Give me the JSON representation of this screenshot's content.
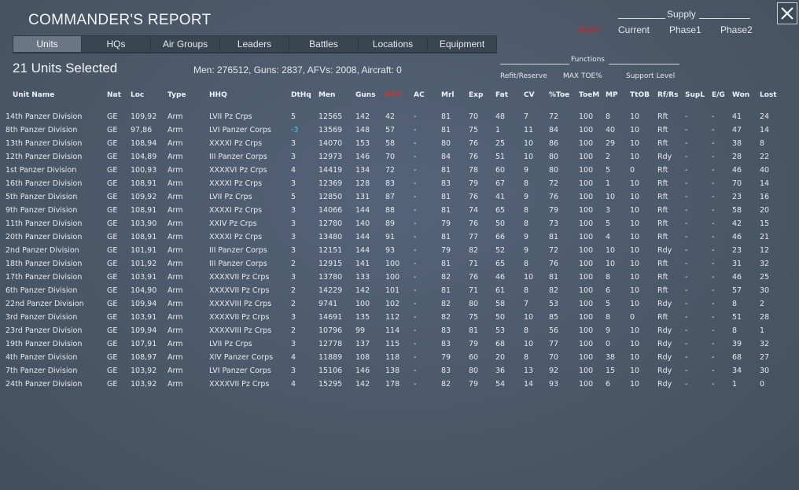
{
  "window": {
    "title": "COMMANDER'S REPORT"
  },
  "supply": {
    "label": "Supply",
    "options": [
      {
        "label": "Main*",
        "active": true
      },
      {
        "label": "Current",
        "active": false
      },
      {
        "label": "Phase1",
        "active": false
      },
      {
        "label": "Phase2",
        "active": false
      }
    ]
  },
  "tabs": [
    {
      "label": "Units",
      "active": true
    },
    {
      "label": "HQs",
      "active": false
    },
    {
      "label": "Air Groups",
      "active": false
    },
    {
      "label": "Leaders",
      "active": false
    },
    {
      "label": "Battles",
      "active": false
    },
    {
      "label": "Locations",
      "active": false
    },
    {
      "label": "Equipment",
      "active": false
    }
  ],
  "selection": {
    "title": "21 Units Selected",
    "summary": "Men: 276512, Guns: 2837, AFVs: 2008, Aircraft: 0"
  },
  "functions": {
    "label": "Functions",
    "options": [
      "Refit/Reserve",
      "MAX TOE%",
      "Support Level"
    ]
  },
  "table": {
    "sort_column": "AFV",
    "columns": [
      "Unit Name",
      "Nat",
      "Loc",
      "Type",
      "HHQ",
      "DtHq",
      "Men",
      "Guns",
      "AFV",
      "AC",
      "Mrl",
      "Exp",
      "Fat",
      "CV",
      "%Toe",
      "ToeM",
      "MP",
      "TtOB",
      "Rf/Rs",
      "SupL",
      "E/G",
      "Won",
      "Lost"
    ],
    "rows": [
      [
        "14th Panzer Division",
        "GE",
        "109,92",
        "Arm",
        "LVII Pz Crps",
        "5",
        "12565",
        "142",
        "42",
        "-",
        "81",
        "70",
        "48",
        "7",
        "72",
        "100",
        "8",
        "10",
        "Rft",
        "-",
        "-",
        "41",
        "24"
      ],
      [
        "8th Panzer Division",
        "GE",
        "97,86",
        "Arm",
        "LVI Panzer Corps",
        "-3",
        "13569",
        "148",
        "57",
        "-",
        "81",
        "75",
        "1",
        "11",
        "84",
        "100",
        "40",
        "10",
        "Rft",
        "-",
        "-",
        "47",
        "14"
      ],
      [
        "13th Panzer Division",
        "GE",
        "108,94",
        "Arm",
        "XXXXI Pz Crps",
        "3",
        "14070",
        "153",
        "58",
        "-",
        "80",
        "76",
        "25",
        "10",
        "86",
        "100",
        "29",
        "10",
        "Rft",
        "-",
        "-",
        "38",
        "8"
      ],
      [
        "12th Panzer Division",
        "GE",
        "104,89",
        "Arm",
        "III Panzer Corps",
        "3",
        "12973",
        "146",
        "70",
        "-",
        "84",
        "76",
        "51",
        "10",
        "80",
        "100",
        "2",
        "10",
        "Rdy",
        "-",
        "-",
        "28",
        "22"
      ],
      [
        "1st Panzer Division",
        "GE",
        "100,93",
        "Arm",
        "XXXXVI Pz Crps",
        "4",
        "14419",
        "134",
        "72",
        "-",
        "81",
        "78",
        "60",
        "9",
        "80",
        "100",
        "5",
        "0",
        "Rft",
        "-",
        "-",
        "46",
        "40"
      ],
      [
        "16th Panzer Division",
        "GE",
        "108,91",
        "Arm",
        "XXXXI Pz Crps",
        "3",
        "12369",
        "128",
        "83",
        "-",
        "83",
        "79",
        "67",
        "8",
        "72",
        "100",
        "1",
        "10",
        "Rft",
        "-",
        "-",
        "70",
        "14"
      ],
      [
        "5th Panzer Division",
        "GE",
        "109,92",
        "Arm",
        "LVII Pz Crps",
        "5",
        "12850",
        "131",
        "87",
        "-",
        "81",
        "76",
        "41",
        "9",
        "76",
        "100",
        "10",
        "10",
        "Rft",
        "-",
        "-",
        "23",
        "16"
      ],
      [
        "9th Panzer Division",
        "GE",
        "108,91",
        "Arm",
        "XXXXI Pz Crps",
        "3",
        "14066",
        "144",
        "88",
        "-",
        "81",
        "74",
        "65",
        "8",
        "79",
        "100",
        "3",
        "10",
        "Rft",
        "-",
        "-",
        "58",
        "20"
      ],
      [
        "11th Panzer Division",
        "GE",
        "103,90",
        "Arm",
        "XXIV Pz Crps",
        "3",
        "12780",
        "140",
        "89",
        "-",
        "79",
        "76",
        "50",
        "8",
        "73",
        "100",
        "5",
        "10",
        "Rft",
        "-",
        "-",
        "42",
        "15"
      ],
      [
        "20th Panzer Division",
        "GE",
        "108,91",
        "Arm",
        "XXXXI Pz Crps",
        "3",
        "13480",
        "144",
        "91",
        "-",
        "81",
        "77",
        "66",
        "9",
        "81",
        "100",
        "4",
        "10",
        "Rft",
        "-",
        "-",
        "46",
        "21"
      ],
      [
        "2nd Panzer Division",
        "GE",
        "101,91",
        "Arm",
        "III Panzer Corps",
        "3",
        "12151",
        "144",
        "93",
        "-",
        "79",
        "82",
        "52",
        "9",
        "72",
        "100",
        "10",
        "10",
        "Rdy",
        "-",
        "-",
        "23",
        "12"
      ],
      [
        "18th Panzer Division",
        "GE",
        "101,92",
        "Arm",
        "III Panzer Corps",
        "2",
        "12915",
        "141",
        "100",
        "-",
        "81",
        "71",
        "65",
        "8",
        "76",
        "100",
        "10",
        "10",
        "Rft",
        "-",
        "-",
        "31",
        "32"
      ],
      [
        "17th Panzer Division",
        "GE",
        "103,91",
        "Arm",
        "XXXXVII Pz Crps",
        "3",
        "13780",
        "133",
        "100",
        "-",
        "82",
        "76",
        "46",
        "10",
        "81",
        "100",
        "8",
        "10",
        "Rft",
        "-",
        "-",
        "46",
        "25"
      ],
      [
        "6th Panzer Division",
        "GE",
        "104,90",
        "Arm",
        "XXXXVII Pz Crps",
        "2",
        "14229",
        "142",
        "101",
        "-",
        "81",
        "71",
        "61",
        "8",
        "82",
        "100",
        "6",
        "10",
        "Rft",
        "-",
        "-",
        "57",
        "30"
      ],
      [
        "22nd Panzer Division",
        "GE",
        "109,94",
        "Arm",
        "XXXXVIII Pz Crps",
        "2",
        "9741",
        "100",
        "102",
        "-",
        "82",
        "80",
        "58",
        "7",
        "53",
        "100",
        "5",
        "10",
        "Rdy",
        "-",
        "-",
        "8",
        "2"
      ],
      [
        "3rd Panzer Division",
        "GE",
        "103,91",
        "Arm",
        "XXXXVII Pz Crps",
        "3",
        "14691",
        "135",
        "112",
        "-",
        "82",
        "75",
        "50",
        "10",
        "85",
        "100",
        "8",
        "0",
        "Rft",
        "-",
        "-",
        "51",
        "28"
      ],
      [
        "23rd Panzer Division",
        "GE",
        "109,94",
        "Arm",
        "XXXXVIII Pz Crps",
        "2",
        "10796",
        "99",
        "114",
        "-",
        "83",
        "81",
        "53",
        "8",
        "56",
        "100",
        "9",
        "10",
        "Rdy",
        "-",
        "-",
        "8",
        "1"
      ],
      [
        "19th Panzer Division",
        "GE",
        "107,91",
        "Arm",
        "LVII Pz Crps",
        "3",
        "12778",
        "137",
        "115",
        "-",
        "83",
        "79",
        "68",
        "10",
        "77",
        "100",
        "0",
        "10",
        "Rdy",
        "-",
        "-",
        "39",
        "32"
      ],
      [
        "4th Panzer Division",
        "GE",
        "108,97",
        "Arm",
        "XIV Panzer Corps",
        "4",
        "11889",
        "108",
        "118",
        "-",
        "79",
        "60",
        "20",
        "8",
        "70",
        "100",
        "38",
        "10",
        "Rdy",
        "-",
        "-",
        "68",
        "27"
      ],
      [
        "7th Panzer Division",
        "GE",
        "103,92",
        "Arm",
        "LVI Panzer Corps",
        "3",
        "15106",
        "146",
        "138",
        "-",
        "83",
        "80",
        "36",
        "13",
        "92",
        "100",
        "15",
        "10",
        "Rdy",
        "-",
        "-",
        "34",
        "30"
      ],
      [
        "24th Panzer Division",
        "GE",
        "103,92",
        "Arm",
        "XXXXVII Pz Crps",
        "4",
        "15295",
        "142",
        "178",
        "-",
        "82",
        "79",
        "54",
        "14",
        "93",
        "100",
        "6",
        "10",
        "Rdy",
        "-",
        "-",
        "1",
        "0"
      ]
    ]
  },
  "icons": {
    "close": "close-icon"
  },
  "colors": {
    "background": "#4b5968",
    "active_tab": "#6a7685",
    "sort_highlight": "#d0332f",
    "supply_active": "#c62a2a",
    "negative_value": "#4ec3f0"
  }
}
